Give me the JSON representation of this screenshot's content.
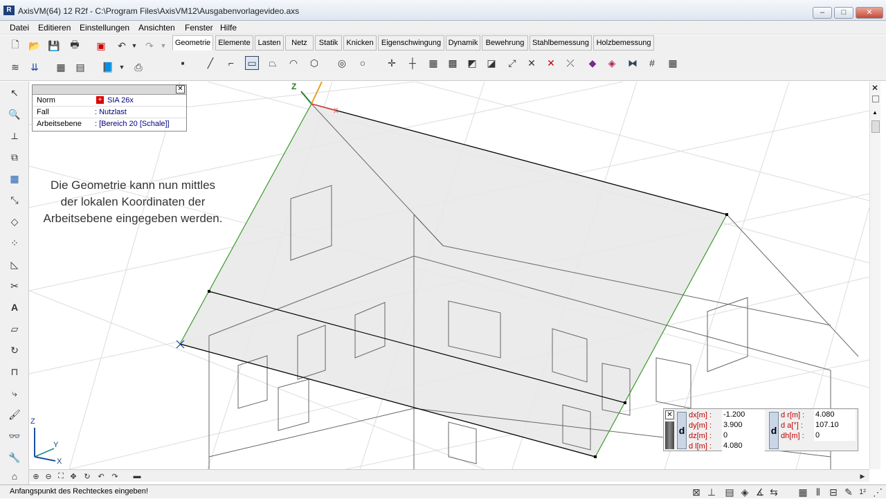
{
  "window": {
    "title": "AxisVM(64) 12 R2f - C:\\Program Files\\AxisVM12\\Ausgabenvorlagevideo.axs",
    "app_icon": "R"
  },
  "menu": [
    "Datei",
    "Editieren",
    "Einstellungen",
    "Ansichten",
    "Fenster",
    "Hilfe"
  ],
  "tabs": [
    "Geometrie",
    "Elemente",
    "Lasten",
    "Netz",
    "Statik",
    "Knicken",
    "Eigenschwingung",
    "Dynamik",
    "Bewehrung",
    "Stahlbemessung",
    "Holzbemessung"
  ],
  "active_tab": "Geometrie",
  "info": {
    "norm_label": "Norm",
    "norm_value": "SIA 26x",
    "fall_label": "Fall",
    "fall_value": ": Nutzlast",
    "ebene_label": "Arbeitsebene",
    "ebene_value": ": [Bereich 20 [Schale]]"
  },
  "caption": "Die Geometrie kann nun mittles der lokalen Koordinaten der Arbeitsebene eingegeben werden.",
  "axes": {
    "z": "Z",
    "y": "Y",
    "x": "X",
    "local_z": "Z",
    "local_x": "X"
  },
  "coords": {
    "dx_label": "dx[m] :",
    "dx": "-1.200",
    "dy_label": "dy[m] :",
    "dy": "3.900",
    "dz_label": "dz[m] :",
    "dz": "0",
    "dl_label": "d l[m] :",
    "dl": "4.080",
    "dr_label": "d r[m] :",
    "dr": "4.080",
    "da_label": "d a[°] :",
    "da": "107.10",
    "dh_label": "dh[m] :",
    "dh": "0",
    "d1": "d",
    "d2": "d"
  },
  "status": "Anfangspunkt des Rechteckes eingeben!",
  "colors": {
    "accent_green": "#3a9a2a",
    "selection": "#d8d8d8",
    "grid": "#d9d9d9"
  }
}
